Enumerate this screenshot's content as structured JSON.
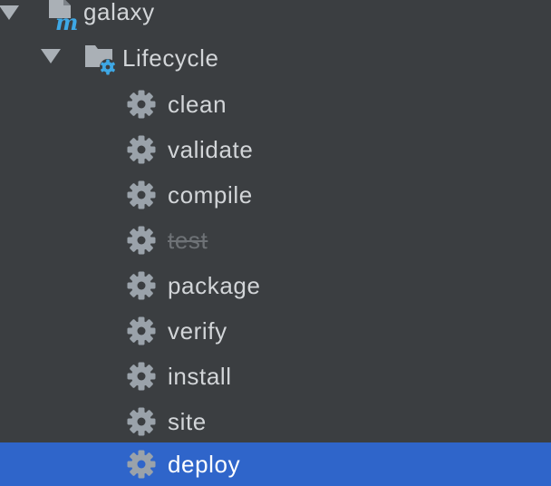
{
  "tree": {
    "project": {
      "label": "galaxy",
      "icon": "maven-module-icon",
      "expanded": true
    },
    "group": {
      "label": "Lifecycle",
      "icon": "folder-gear-icon",
      "expanded": true
    },
    "phases": [
      {
        "label": "clean",
        "icon": "gear-icon",
        "disabled": false,
        "selected": false
      },
      {
        "label": "validate",
        "icon": "gear-icon",
        "disabled": false,
        "selected": false
      },
      {
        "label": "compile",
        "icon": "gear-icon",
        "disabled": false,
        "selected": false
      },
      {
        "label": "test",
        "icon": "gear-icon",
        "disabled": true,
        "selected": false
      },
      {
        "label": "package",
        "icon": "gear-icon",
        "disabled": false,
        "selected": false
      },
      {
        "label": "verify",
        "icon": "gear-icon",
        "disabled": false,
        "selected": false
      },
      {
        "label": "install",
        "icon": "gear-icon",
        "disabled": false,
        "selected": false
      },
      {
        "label": "site",
        "icon": "gear-icon",
        "disabled": false,
        "selected": false
      },
      {
        "label": "deploy",
        "icon": "gear-icon",
        "disabled": false,
        "selected": true
      }
    ]
  },
  "colors": {
    "background": "#3b3e41",
    "selection": "#2f65ca",
    "text": "#d2d5d8",
    "disabled_text": "#6e7276",
    "gear": "#9aa2aa",
    "accent_blue": "#3ea8e5"
  }
}
